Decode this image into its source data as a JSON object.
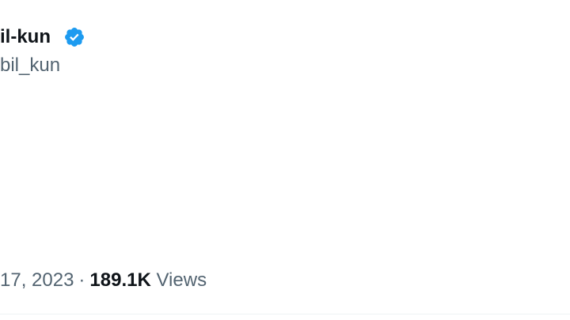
{
  "tweet": {
    "author_name": "il-kun",
    "author_handle": "bil_kun",
    "verified_badge_color": "#1d9bf0",
    "verified_icon": "verified-badge-icon",
    "date": "17, 2023",
    "separator": "·",
    "views_count": "189.1K",
    "views_label": "Views"
  }
}
